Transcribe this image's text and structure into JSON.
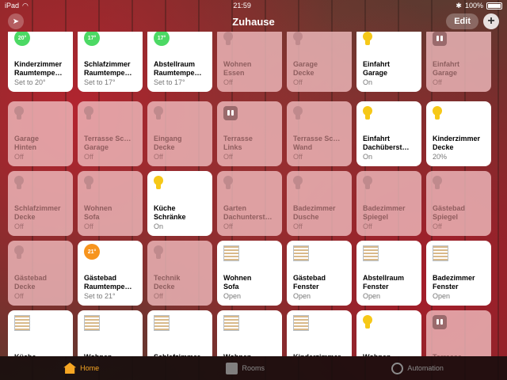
{
  "status": {
    "device": "iPad",
    "time": "21:59",
    "battery": "100%"
  },
  "header": {
    "title": "Zuhause",
    "edit_label": "Edit",
    "add_label": "+"
  },
  "tiles": [
    {
      "name1": "Kinderzimmer",
      "name2": "Raumtempe…",
      "status": "Set to 20°",
      "kind": "thermo",
      "active": true,
      "value": "20°",
      "color": "#4cd964"
    },
    {
      "name1": "Schlafzimmer",
      "name2": "Raumtempe…",
      "status": "Set to 17°",
      "kind": "thermo",
      "active": true,
      "value": "17°",
      "color": "#4cd964"
    },
    {
      "name1": "Abstellraum",
      "name2": "Raumtempe…",
      "status": "Set to 17°",
      "kind": "thermo",
      "active": true,
      "value": "17°",
      "color": "#4cd964"
    },
    {
      "name1": "Wohnen",
      "name2": "Essen",
      "status": "Off",
      "kind": "bulb",
      "active": false
    },
    {
      "name1": "Garage",
      "name2": "Decke",
      "status": "Off",
      "kind": "bulb",
      "active": false
    },
    {
      "name1": "Einfahrt",
      "name2": "Garage",
      "status": "On",
      "kind": "bulb",
      "active": true
    },
    {
      "name1": "Einfahrt",
      "name2": "Garage",
      "status": "Off",
      "kind": "outlet",
      "active": false
    },
    {
      "name1": "Garage",
      "name2": "Hinten",
      "status": "Off",
      "kind": "bulb",
      "active": false
    },
    {
      "name1": "Terrasse Sc…",
      "name2": "Garage",
      "status": "Off",
      "kind": "bulb",
      "active": false
    },
    {
      "name1": "Eingang",
      "name2": "Decke",
      "status": "Off",
      "kind": "bulb",
      "active": false
    },
    {
      "name1": "Terrasse",
      "name2": "Links",
      "status": "Off",
      "kind": "outlet",
      "active": false
    },
    {
      "name1": "Terrasse Sc…",
      "name2": "Wand",
      "status": "Off",
      "kind": "bulb",
      "active": false
    },
    {
      "name1": "Einfahrt",
      "name2": "Dachüberst…",
      "status": "On",
      "kind": "bulb",
      "active": true
    },
    {
      "name1": "Kinderzimmer",
      "name2": "Decke",
      "status": "20%",
      "kind": "bulb",
      "active": true
    },
    {
      "name1": "Schlafzimmer",
      "name2": "Decke",
      "status": "Off",
      "kind": "bulb",
      "active": false
    },
    {
      "name1": "Wohnen",
      "name2": "Sofa",
      "status": "Off",
      "kind": "bulb",
      "active": false
    },
    {
      "name1": "Küche",
      "name2": "Schränke",
      "status": "On",
      "kind": "bulb",
      "active": true
    },
    {
      "name1": "Garten",
      "name2": "Dachunterst…",
      "status": "Off",
      "kind": "bulb",
      "active": false
    },
    {
      "name1": "Badezimmer",
      "name2": "Dusche",
      "status": "Off",
      "kind": "bulb",
      "active": false
    },
    {
      "name1": "Badezimmer",
      "name2": "Spiegel",
      "status": "Off",
      "kind": "bulb",
      "active": false
    },
    {
      "name1": "Gästebad",
      "name2": "Spiegel",
      "status": "Off",
      "kind": "bulb",
      "active": false
    },
    {
      "name1": "Gästebad",
      "name2": "Decke",
      "status": "Off",
      "kind": "bulb",
      "active": false
    },
    {
      "name1": "Gästebad",
      "name2": "Raumtempe…",
      "status": "Set to 21°",
      "kind": "thermo",
      "active": true,
      "value": "21°",
      "color": "#f7941d"
    },
    {
      "name1": "Technik",
      "name2": "Decke",
      "status": "Off",
      "kind": "bulb",
      "active": false
    },
    {
      "name1": "Wohnen",
      "name2": "Sofa",
      "status": "Open",
      "kind": "blind",
      "active": true
    },
    {
      "name1": "Gästebad",
      "name2": "Fenster",
      "status": "Open",
      "kind": "blind",
      "active": true
    },
    {
      "name1": "Abstellraum",
      "name2": "Fenster",
      "status": "Open",
      "kind": "blind",
      "active": true
    },
    {
      "name1": "Badezimmer",
      "name2": "Fenster",
      "status": "Open",
      "kind": "blind",
      "active": true
    },
    {
      "name1": "Küche",
      "name2": "Fenster",
      "status": "",
      "kind": "blind",
      "active": true
    },
    {
      "name1": "Wohnen",
      "name2": "Fenster",
      "status": "",
      "kind": "blind",
      "active": true
    },
    {
      "name1": "Schlafzimmer",
      "name2": "Fenster",
      "status": "",
      "kind": "blind",
      "active": true
    },
    {
      "name1": "Wohnen",
      "name2": "Fenster",
      "status": "",
      "kind": "blind",
      "active": true
    },
    {
      "name1": "Kinderzimmer",
      "name2": "Fenster",
      "status": "",
      "kind": "blind",
      "active": true
    },
    {
      "name1": "Wohnen",
      "name2": "Stehlampe",
      "status": "",
      "kind": "bulb",
      "active": true
    },
    {
      "name1": "Terrasse",
      "name2": "Rechts",
      "status": "",
      "kind": "outlet",
      "active": false
    }
  ],
  "tabs": [
    {
      "label": "Home",
      "active": true,
      "icon": "house-icon"
    },
    {
      "label": "Rooms",
      "active": false,
      "icon": "rooms-icon"
    },
    {
      "label": "Automation",
      "active": false,
      "icon": "automation-icon"
    }
  ]
}
